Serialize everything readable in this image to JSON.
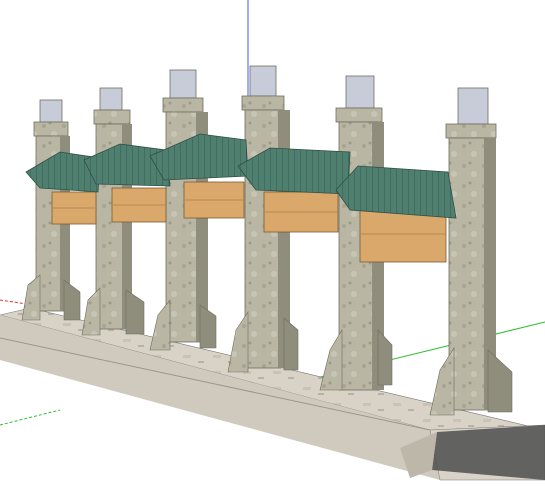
{
  "viewport": {
    "background": "#ffffff",
    "axis_colors": {
      "blue": "#3b5bff",
      "green": "#2fbf2f",
      "red": "#e23232"
    }
  },
  "model": {
    "name_icon": "paifang-memorial-archway-icon",
    "colors": {
      "stone": "#b9b7a4",
      "stone_dark": "#8f8d7c",
      "stone_shadow": "#6f6d60",
      "roof_green": "#4f7f6f",
      "roof_dark": "#2f4f46",
      "panel_wood": "#d9a86a",
      "panel_wood_dark": "#b98952",
      "cap_stone": "#c8ccd8",
      "platform": "#d8d3c6",
      "platform_shadow": "#555555"
    }
  }
}
